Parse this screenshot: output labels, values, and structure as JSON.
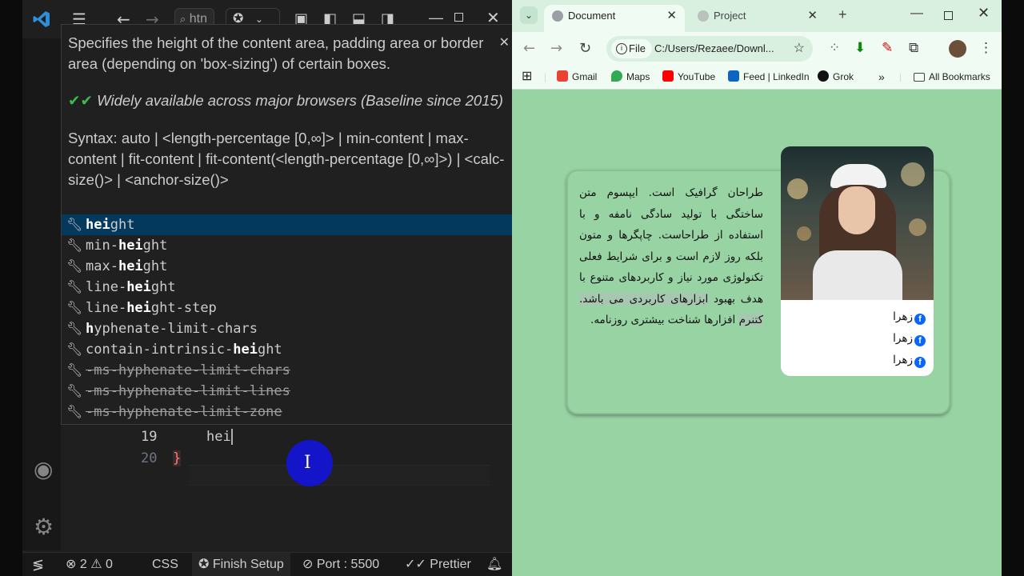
{
  "vscode": {
    "search_text": "htn",
    "hover": {
      "description": "Specifies the height of the content area, padding area or border area (depending on 'box-sizing') of certain boxes.",
      "baseline": "Widely available across major browsers (Baseline since 2015)",
      "syntax": "Syntax: auto | <length-percentage [0,∞]> | min-content | max-content | fit-content | fit-content(<length-percentage [0,∞]>) | <calc-size()> | <anchor-size()>"
    },
    "suggestions": [
      {
        "pre": "",
        "match": "hei",
        "post": "ght",
        "deprecated": false
      },
      {
        "pre": "min-",
        "match": "hei",
        "post": "ght",
        "deprecated": false
      },
      {
        "pre": "max-",
        "match": "hei",
        "post": "ght",
        "deprecated": false
      },
      {
        "pre": "line-",
        "match": "hei",
        "post": "ght",
        "deprecated": false
      },
      {
        "pre": "line-",
        "match": "hei",
        "post": "ght-step",
        "deprecated": false
      },
      {
        "pre": "",
        "match": "h",
        "post": "yphenate-limit-chars",
        "deprecated": false
      },
      {
        "pre": "contain-intrinsic-",
        "match": "hei",
        "post": "ght",
        "deprecated": false
      },
      {
        "pre": "-ms-hyphenate-limit-chars",
        "match": "",
        "post": "",
        "deprecated": true
      },
      {
        "pre": "-ms-hyphenate-limit-lines",
        "match": "",
        "post": "",
        "deprecated": true
      },
      {
        "pre": "-ms-hyphenate-limit-zone",
        "match": "",
        "post": "",
        "deprecated": true
      }
    ],
    "lines": [
      {
        "num": "19",
        "text": "hei"
      },
      {
        "num": "20",
        "text": "}"
      }
    ],
    "status": {
      "errors": "2",
      "warnings": "0",
      "language": "CSS",
      "finish_setup": "Finish Setup",
      "port": "Port : 5500",
      "prettier": "Prettier"
    }
  },
  "chrome": {
    "tabs": [
      {
        "title": "Document"
      },
      {
        "title": "Project"
      }
    ],
    "address": {
      "chip": "File",
      "url": "C:/Users/Rezaee/Downl..."
    },
    "bookmarks": [
      "Gmail",
      "Maps",
      "YouTube",
      "Feed | LinkedIn",
      "Grok"
    ],
    "all_bookmarks": "All Bookmarks",
    "page": {
      "paragraph_main": "طراحان گرافیک است. ایپسوم متن ساختگی با تولید سادگی نامفه و با استفاده از طراحاست. چاپگرها و متون بلکه روز لازم است و برای شرایط فعلی تکنولوژی مورد نیاز و کاربردهای متنوع با هدف بهبود",
      "paragraph_highlight": "ابزارهای کاربردی می باشد. کتنرم",
      "paragraph_end": "افزارها شناخت بیشتری روزنامه.",
      "names": [
        "زهرا",
        "زهرا",
        "زهرا"
      ]
    },
    "colors": {
      "page_bg": "#98d3a3",
      "facebook": "#0866ff"
    }
  }
}
